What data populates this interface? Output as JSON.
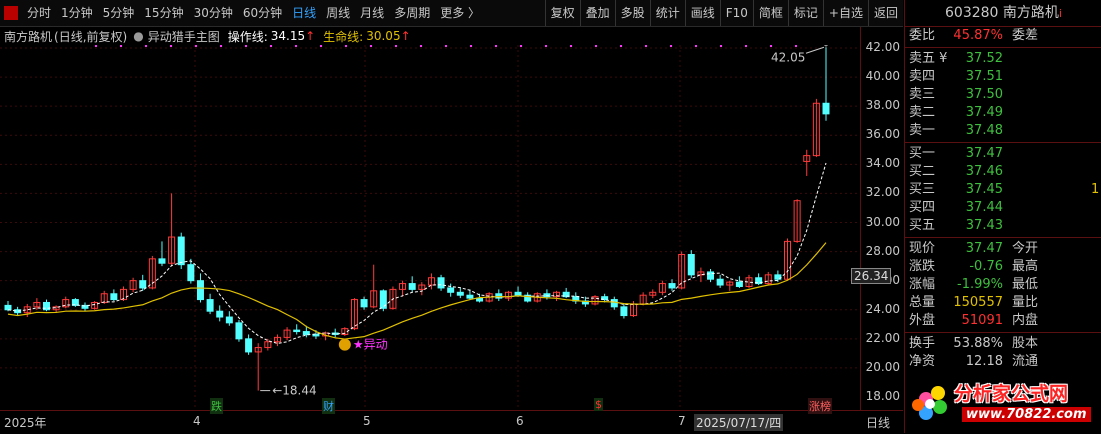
{
  "toolbar": {
    "periods": [
      "分时",
      "1分钟",
      "5分钟",
      "15分钟",
      "30分钟",
      "60分钟",
      "日线",
      "周线",
      "月线",
      "多周期",
      "更多 〉"
    ],
    "active_period": "日线",
    "buttons": [
      "复权",
      "叠加",
      "多股",
      "统计",
      "画线",
      "F10",
      "简框",
      "标记",
      "+自选",
      "返回"
    ]
  },
  "info": {
    "stock_name": "南方路机",
    "mode": "(日线,前复权)",
    "indicator": "异动猎手主图",
    "op_label": "操作线:",
    "op_value": "34.15",
    "life_label": "生命线:",
    "life_value": "30.05"
  },
  "axis": {
    "ticks": [
      "42.00",
      "40.00",
      "38.00",
      "36.00",
      "34.00",
      "32.00",
      "30.00",
      "28.00",
      "26.00",
      "24.00",
      "22.00",
      "20.00",
      "18.00"
    ],
    "current": "26.34"
  },
  "annotations": {
    "high": "42.05",
    "low": "18.44",
    "yidong": "★异动",
    "markers": [
      "跌",
      "财",
      "$",
      "涨榜"
    ]
  },
  "xaxis": {
    "labels": [
      "2025年",
      "4",
      "5",
      "6",
      "7",
      "2025/07/17/四"
    ],
    "unit": "日线"
  },
  "panel": {
    "code": "603280",
    "name": "南方路机",
    "weibi_label": "委比",
    "weibi": "45.87%",
    "weicha_label": "委差",
    "sells": [
      {
        "label": "卖五 ¥",
        "price": "37.52"
      },
      {
        "label": "卖四",
        "price": "37.51"
      },
      {
        "label": "卖三",
        "price": "37.50"
      },
      {
        "label": "卖二",
        "price": "37.49"
      },
      {
        "label": "卖一",
        "price": "37.48"
      }
    ],
    "buys": [
      {
        "label": "买一",
        "price": "37.47"
      },
      {
        "label": "买二",
        "price": "37.46"
      },
      {
        "label": "买三",
        "price": "37.45",
        "vol": "1"
      },
      {
        "label": "买四",
        "price": "37.44"
      },
      {
        "label": "买五",
        "price": "37.43"
      }
    ],
    "quote": [
      {
        "l": "现价",
        "v": "37.47",
        "l2": "今开",
        "c": "grn"
      },
      {
        "l": "涨跌",
        "v": "-0.76",
        "l2": "最高",
        "c": "grn"
      },
      {
        "l": "涨幅",
        "v": "-1.99%",
        "l2": "最低",
        "c": "grn"
      },
      {
        "l": "总量",
        "v": "150557",
        "l2": "量比",
        "c": "yel"
      },
      {
        "l": "外盘",
        "v": "51091",
        "l2": "内盘",
        "c": "red"
      }
    ],
    "extra": [
      {
        "l": "换手",
        "v": "53.88%",
        "l2": "股本"
      },
      {
        "l": "净资",
        "v": "12.18",
        "l2": "流通"
      }
    ]
  },
  "watermark": {
    "name": "分析家公式网",
    "url": "www.70822.com"
  },
  "chart_data": {
    "type": "candlestick",
    "ylim": [
      18,
      42.5
    ],
    "candles": [
      [
        24.3,
        24.6,
        23.9,
        24.0
      ],
      [
        24.0,
        24.2,
        23.6,
        23.8
      ],
      [
        23.8,
        24.4,
        23.5,
        24.2
      ],
      [
        24.2,
        24.8,
        24.0,
        24.5
      ],
      [
        24.5,
        24.7,
        23.9,
        24.0
      ],
      [
        24.0,
        24.3,
        23.8,
        24.2
      ],
      [
        24.2,
        24.9,
        24.1,
        24.7
      ],
      [
        24.7,
        24.8,
        24.2,
        24.3
      ],
      [
        24.3,
        24.5,
        23.9,
        24.1
      ],
      [
        24.1,
        24.6,
        24.0,
        24.5
      ],
      [
        24.5,
        25.3,
        24.4,
        25.1
      ],
      [
        25.1,
        25.4,
        24.6,
        24.7
      ],
      [
        24.7,
        25.6,
        24.6,
        25.4
      ],
      [
        25.4,
        26.2,
        25.2,
        26.0
      ],
      [
        26.0,
        26.4,
        25.3,
        25.5
      ],
      [
        25.5,
        27.7,
        25.4,
        27.5
      ],
      [
        27.5,
        28.7,
        27.0,
        27.2
      ],
      [
        27.2,
        32.0,
        27.0,
        29.0
      ],
      [
        29.0,
        29.3,
        26.8,
        27.1
      ],
      [
        27.1,
        27.5,
        25.8,
        26.0
      ],
      [
        26.0,
        26.5,
        24.5,
        24.7
      ],
      [
        24.7,
        25.1,
        23.7,
        23.9
      ],
      [
        23.9,
        24.3,
        23.2,
        23.5
      ],
      [
        23.5,
        23.9,
        22.9,
        23.1
      ],
      [
        23.1,
        23.3,
        21.8,
        22.0
      ],
      [
        22.0,
        22.3,
        20.9,
        21.1
      ],
      [
        21.1,
        21.7,
        18.44,
        21.4
      ],
      [
        21.4,
        22.0,
        21.2,
        21.8
      ],
      [
        21.8,
        22.3,
        21.5,
        22.1
      ],
      [
        22.1,
        22.8,
        21.9,
        22.6
      ],
      [
        22.6,
        23.0,
        22.3,
        22.5
      ],
      [
        22.5,
        22.9,
        22.1,
        22.3
      ],
      [
        22.3,
        22.6,
        22.0,
        22.2
      ],
      [
        22.2,
        22.5,
        21.9,
        22.4
      ],
      [
        22.4,
        22.7,
        22.1,
        22.3
      ],
      [
        22.3,
        22.8,
        22.2,
        22.7
      ],
      [
        22.7,
        24.8,
        22.6,
        24.7
      ],
      [
        24.7,
        24.9,
        24.0,
        24.2
      ],
      [
        24.2,
        27.1,
        24.1,
        25.3
      ],
      [
        25.3,
        25.4,
        23.9,
        24.1
      ],
      [
        24.1,
        25.6,
        24.0,
        25.4
      ],
      [
        25.4,
        26.0,
        24.9,
        25.8
      ],
      [
        25.8,
        26.3,
        25.2,
        25.4
      ],
      [
        25.4,
        25.9,
        25.0,
        25.7
      ],
      [
        25.7,
        26.5,
        25.4,
        26.2
      ],
      [
        26.2,
        26.4,
        25.3,
        25.5
      ],
      [
        25.5,
        25.8,
        24.9,
        25.2
      ],
      [
        25.2,
        25.5,
        24.8,
        25.0
      ],
      [
        25.0,
        25.4,
        24.7,
        24.8
      ],
      [
        24.8,
        25.1,
        24.5,
        24.6
      ],
      [
        24.6,
        25.2,
        24.5,
        25.1
      ],
      [
        25.1,
        25.4,
        24.6,
        24.8
      ],
      [
        24.8,
        25.3,
        24.6,
        25.2
      ],
      [
        25.2,
        25.6,
        24.9,
        25.0
      ],
      [
        25.0,
        25.2,
        24.5,
        24.6
      ],
      [
        24.6,
        25.2,
        24.5,
        25.1
      ],
      [
        25.1,
        25.4,
        24.7,
        24.9
      ],
      [
        24.9,
        25.3,
        24.6,
        25.2
      ],
      [
        25.2,
        25.5,
        24.8,
        24.9
      ],
      [
        24.9,
        25.2,
        24.4,
        24.6
      ],
      [
        24.6,
        24.9,
        24.2,
        24.4
      ],
      [
        24.4,
        25.0,
        24.3,
        24.9
      ],
      [
        24.9,
        25.1,
        24.5,
        24.7
      ],
      [
        24.7,
        24.9,
        24.0,
        24.2
      ],
      [
        24.2,
        24.4,
        23.4,
        23.6
      ],
      [
        23.6,
        24.6,
        23.5,
        24.4
      ],
      [
        24.4,
        25.2,
        24.3,
        25.0
      ],
      [
        25.0,
        25.4,
        24.8,
        25.2
      ],
      [
        25.2,
        26.0,
        25.0,
        25.8
      ],
      [
        25.8,
        26.1,
        25.3,
        25.5
      ],
      [
        25.5,
        28.0,
        25.4,
        27.8
      ],
      [
        27.8,
        28.1,
        26.2,
        26.4
      ],
      [
        26.4,
        26.9,
        25.9,
        26.6
      ],
      [
        26.6,
        26.8,
        25.9,
        26.1
      ],
      [
        26.1,
        26.4,
        25.5,
        25.7
      ],
      [
        25.7,
        26.0,
        25.3,
        25.9
      ],
      [
        25.9,
        26.3,
        25.5,
        25.6
      ],
      [
        25.6,
        26.4,
        25.5,
        26.2
      ],
      [
        26.2,
        26.5,
        25.7,
        25.8
      ],
      [
        25.8,
        26.6,
        25.7,
        26.4
      ],
      [
        26.4,
        26.7,
        25.9,
        26.1
      ],
      [
        26.1,
        28.9,
        26.0,
        28.7
      ],
      [
        28.7,
        31.6,
        28.6,
        31.5
      ],
      [
        34.2,
        35.0,
        33.2,
        34.6
      ],
      [
        34.6,
        38.5,
        34.5,
        38.2
      ],
      [
        38.2,
        42.05,
        37.0,
        37.47
      ]
    ]
  }
}
